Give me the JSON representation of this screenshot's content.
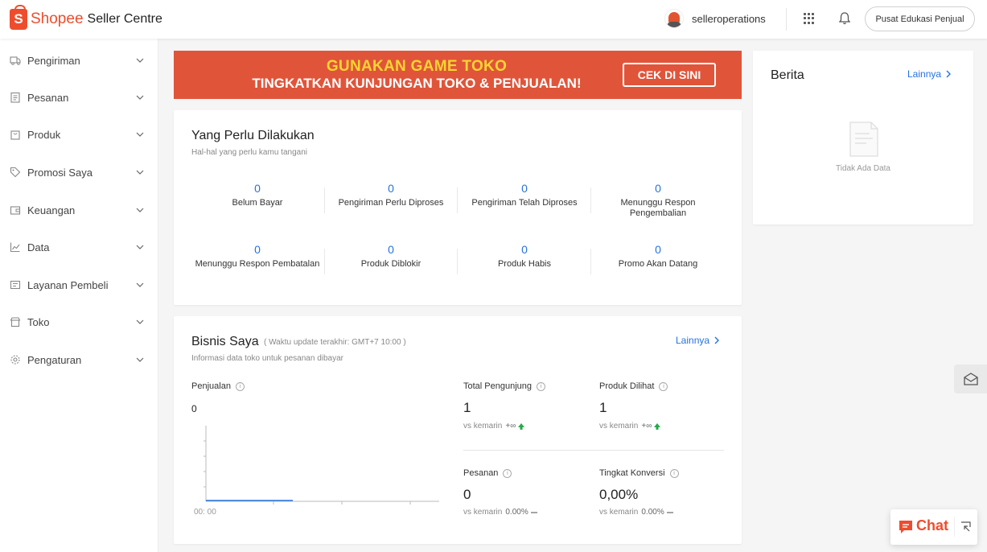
{
  "header": {
    "logo_mark": "S",
    "brand": "Shopee",
    "product": "Seller Centre",
    "username": "selleroperations",
    "edu_button": "Pusat Edukasi Penjual"
  },
  "sidebar": {
    "items": [
      {
        "label": "Pengiriman",
        "icon": "truck-icon"
      },
      {
        "label": "Pesanan",
        "icon": "clipboard-icon"
      },
      {
        "label": "Produk",
        "icon": "bag-icon"
      },
      {
        "label": "Promosi Saya",
        "icon": "tag-icon"
      },
      {
        "label": "Keuangan",
        "icon": "wallet-icon"
      },
      {
        "label": "Data",
        "icon": "line-chart-icon"
      },
      {
        "label": "Layanan Pembeli",
        "icon": "support-icon"
      },
      {
        "label": "Toko",
        "icon": "store-icon"
      },
      {
        "label": "Pengaturan",
        "icon": "gear-icon"
      }
    ]
  },
  "banner": {
    "line1": "GUNAKAN GAME TOKO",
    "line2": "TINGKATKAN KUNJUNGAN TOKO & PENJUALAN!",
    "button": "CEK DI SINI",
    "bg_color": "#e0553a",
    "highlight_color": "#f8d531"
  },
  "todo": {
    "title": "Yang Perlu Dilakukan",
    "subtitle": "Hal-hal yang perlu kamu tangani",
    "items": [
      {
        "value": "0",
        "label": "Belum Bayar"
      },
      {
        "value": "0",
        "label": "Pengiriman Perlu Diproses"
      },
      {
        "value": "0",
        "label": "Pengiriman Telah Diproses"
      },
      {
        "value": "0",
        "label": "Menunggu Respon Pengembalian"
      },
      {
        "value": "0",
        "label": "Menunggu Respon Pembatalan"
      },
      {
        "value": "0",
        "label": "Produk Diblokir"
      },
      {
        "value": "0",
        "label": "Produk Habis"
      },
      {
        "value": "0",
        "label": "Promo Akan Datang"
      }
    ]
  },
  "business": {
    "title": "Bisnis Saya",
    "update_note": "( Waktu update terakhir: GMT+7 10:00 )",
    "subtitle": "Informasi data toko untuk pesanan dibayar",
    "more": "Lainnya",
    "sales_label": "Penjualan",
    "sales_value": "0",
    "chart_time": "00: 00",
    "metrics": [
      {
        "label": "Total Pengunjung",
        "value": "1",
        "compare": "vs kemarin",
        "delta": "+∞",
        "trend": "up"
      },
      {
        "label": "Produk Dilihat",
        "value": "1",
        "compare": "vs kemarin",
        "delta": "+∞",
        "trend": "up"
      },
      {
        "label": "Pesanan",
        "value": "0",
        "compare": "vs kemarin",
        "delta": "0.00%",
        "trend": "flat"
      },
      {
        "label": "Tingkat Konversi",
        "value": "0,00%",
        "compare": "vs kemarin",
        "delta": "0.00%",
        "trend": "flat"
      }
    ]
  },
  "news": {
    "title": "Berita",
    "more": "Lainnya",
    "empty": "Tidak Ada Data"
  },
  "chat": {
    "label": "Chat"
  },
  "colors": {
    "accent": "#ee4d2d",
    "link": "#2673dd",
    "up": "#26aa49"
  }
}
